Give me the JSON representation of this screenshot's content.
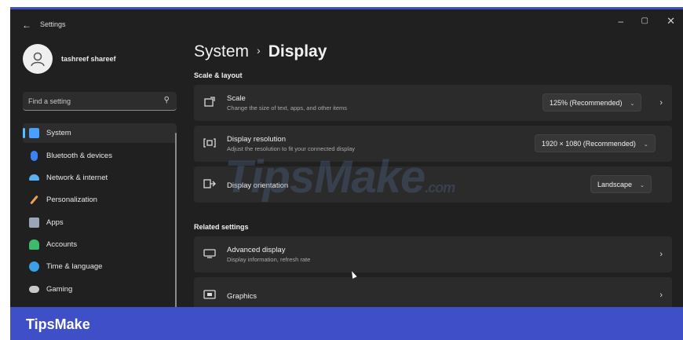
{
  "window": {
    "app_title": "Settings",
    "back_glyph": "←",
    "minimize_glyph": "–",
    "maximize_glyph": "▢",
    "close_glyph": "✕"
  },
  "user": {
    "name": "tashreef shareef",
    "avatar_icon": "person-icon"
  },
  "search": {
    "placeholder": "Find a setting",
    "icon": "search-icon"
  },
  "nav": {
    "accent": "#4cc2ff",
    "items": [
      {
        "label": "System",
        "icon": "monitor-icon",
        "color": "#4a9eff",
        "active": true
      },
      {
        "label": "Bluetooth & devices",
        "icon": "bluetooth-icon",
        "color": "#3b82f6",
        "active": false
      },
      {
        "label": "Network & internet",
        "icon": "wifi-icon",
        "color": "#5ab0f0",
        "active": false
      },
      {
        "label": "Personalization",
        "icon": "brush-icon",
        "color": "#f0a050",
        "active": false
      },
      {
        "label": "Apps",
        "icon": "apps-icon",
        "color": "#9aa6b8",
        "active": false
      },
      {
        "label": "Accounts",
        "icon": "account-icon",
        "color": "#3dbb6a",
        "active": false
      },
      {
        "label": "Time & language",
        "icon": "globe-icon",
        "color": "#3aa0e8",
        "active": false
      },
      {
        "label": "Gaming",
        "icon": "gamepad-icon",
        "color": "#c8c8c8",
        "active": false
      }
    ]
  },
  "breadcrumb": {
    "parent": "System",
    "separator": "›",
    "current": "Display"
  },
  "scale_layout": {
    "heading": "Scale & layout",
    "scale": {
      "title": "Scale",
      "subtitle": "Change the size of text, apps, and other items",
      "value": "125% (Recommended)",
      "icon": "scale-icon"
    },
    "resolution": {
      "title": "Display resolution",
      "subtitle": "Adjust the resolution to fit your connected display",
      "value": "1920 × 1080 (Recommended)",
      "icon": "resolution-icon"
    },
    "orientation": {
      "title": "Display orientation",
      "value": "Landscape",
      "icon": "orientation-icon"
    }
  },
  "related": {
    "heading": "Related settings",
    "advanced": {
      "title": "Advanced display",
      "subtitle": "Display information, refresh rate",
      "icon": "monitor-icon"
    },
    "graphics": {
      "title": "Graphics",
      "icon": "graphics-icon"
    }
  },
  "watermark": {
    "text": "TipsMake",
    "suffix": ".com"
  },
  "brand": {
    "text": "TipsMake",
    "color": "#3f4fc8"
  }
}
